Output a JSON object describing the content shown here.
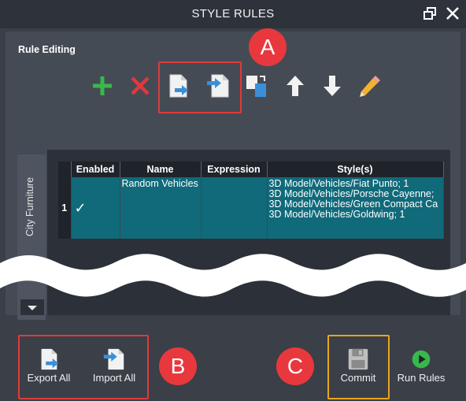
{
  "window": {
    "title": "STYLE RULES"
  },
  "section": {
    "title": "Rule Editing"
  },
  "toolbar": {
    "tools": [
      "add-rule",
      "delete-rule",
      "export-rule",
      "import-rule",
      "copy-rule",
      "move-up",
      "move-down",
      "edit-rule"
    ]
  },
  "tabs": {
    "active": "City Furniture"
  },
  "table": {
    "headers": [
      "Enabled",
      "Name",
      "Expression",
      "Style(s)"
    ],
    "rows": [
      {
        "num": "1",
        "enabled": "✓",
        "name": "Random Vehicles",
        "expression": "",
        "styles": [
          "3D Model/Vehicles/Fiat Punto; 1",
          "3D Model/Vehicles/Porsche Cayenne;",
          "3D Model/Vehicles/Green Compact Ca",
          "3D Model/Vehicles/Goldwing; 1"
        ]
      }
    ]
  },
  "buttons": {
    "export_all": "Export All",
    "import_all": "Import All",
    "commit": "Commit",
    "run_rules": "Run Rules"
  },
  "callouts": {
    "a": "A",
    "b": "B",
    "c": "C"
  },
  "colors": {
    "background": "#3a3f48",
    "selected_row": "#106a7a",
    "callout_red": "#e8383d",
    "commit_highlight": "#e8a619",
    "add_green": "#38b84c",
    "delete_red": "#e0383d"
  }
}
